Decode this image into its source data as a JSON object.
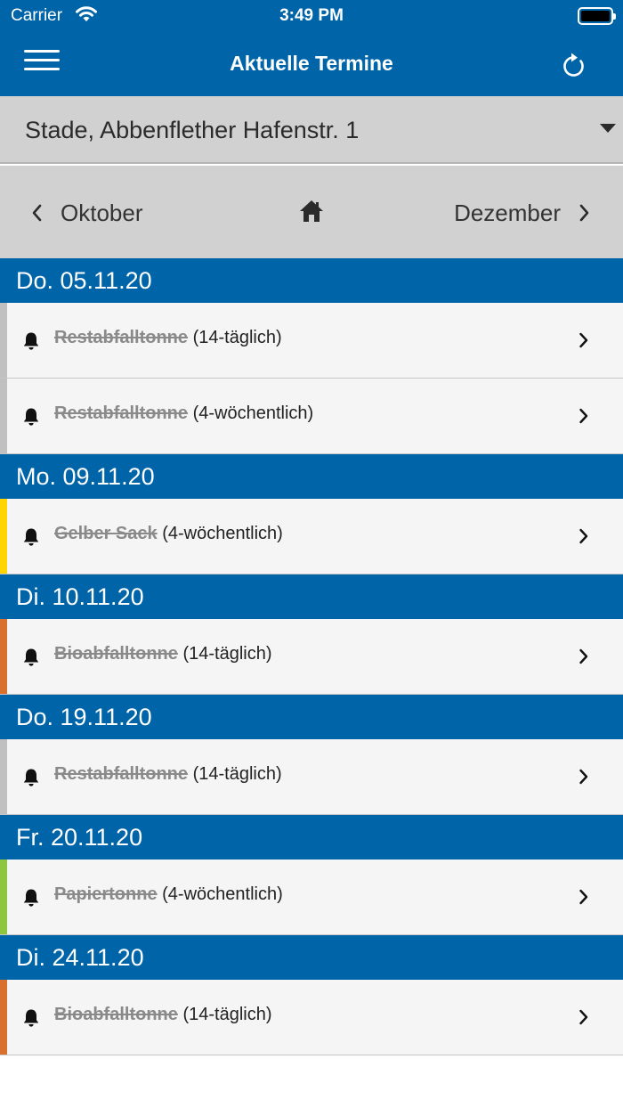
{
  "status_bar": {
    "carrier": "Carrier",
    "time": "3:49 PM"
  },
  "header": {
    "title": "Aktuelle Termine"
  },
  "location": {
    "label": "Stade, Abbenflether Hafenstr. 1"
  },
  "month_nav": {
    "prev_label": "Oktober",
    "next_label": "Dezember"
  },
  "colors": {
    "brand_blue": "#0064a8",
    "rest": "#c0c0c0",
    "gelb": "#ffd400",
    "bio": "#d8702e",
    "papier": "#8dc63f"
  },
  "dates": [
    {
      "label": "Do. 05.11.20",
      "entries": [
        {
          "name": "Restabfalltonne",
          "freq": "(14-täglich)",
          "color": "#c0c0c0"
        },
        {
          "name": "Restabfalltonne",
          "freq": "(4-wöchentlich)",
          "color": "#c0c0c0"
        }
      ]
    },
    {
      "label": "Mo. 09.11.20",
      "entries": [
        {
          "name": "Gelber Sack",
          "freq": "(4-wöchentlich)",
          "color": "#ffd400"
        }
      ]
    },
    {
      "label": "Di. 10.11.20",
      "entries": [
        {
          "name": "Bioabfalltonne",
          "freq": "(14-täglich)",
          "color": "#d8702e"
        }
      ]
    },
    {
      "label": "Do. 19.11.20",
      "entries": [
        {
          "name": "Restabfalltonne",
          "freq": "(14-täglich)",
          "color": "#c0c0c0"
        }
      ]
    },
    {
      "label": "Fr. 20.11.20",
      "entries": [
        {
          "name": "Papiertonne",
          "freq": "(4-wöchentlich)",
          "color": "#8dc63f"
        }
      ]
    },
    {
      "label": "Di. 24.11.20",
      "entries": [
        {
          "name": "Bioabfalltonne",
          "freq": "(14-täglich)",
          "color": "#d8702e"
        }
      ]
    }
  ]
}
